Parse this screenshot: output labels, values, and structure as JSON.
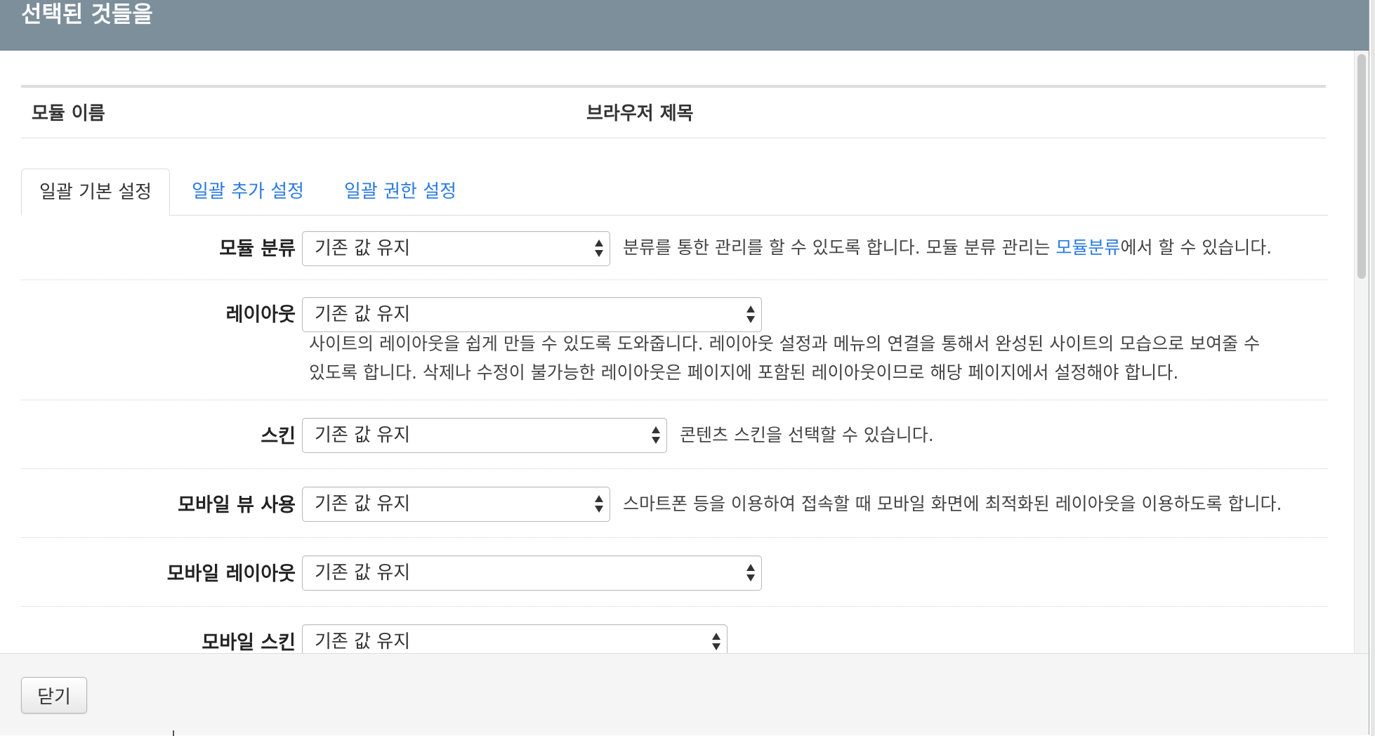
{
  "header": {
    "title": "선택된 것들을"
  },
  "table": {
    "col_module_name": "모듈 이름",
    "col_browser_title": "브라우저 제목"
  },
  "tabs": [
    {
      "label": "일괄 기본 설정",
      "active": true
    },
    {
      "label": "일괄 추가 설정",
      "active": false
    },
    {
      "label": "일괄 권한 설정",
      "active": false
    }
  ],
  "form": {
    "module_category": {
      "label": "모듈 분류",
      "value": "기존 값 유지",
      "help_before": "분류를 통한 관리를 할 수 있도록 합니다. 모듈 분류 관리는 ",
      "help_link": "모듈분류",
      "help_after": "에서 할 수 있습니다."
    },
    "layout": {
      "label": "레이아웃",
      "value": "기존 값 유지",
      "help_line1": "사이트의 레이아웃을 쉽게 만들 수 있도록 도와줍니다. 레이아웃 설정과 메뉴의 연결을 통해서 완성된 사이트의 모습으로 보여줄 수",
      "help_line2": "있도록 합니다. 삭제나 수정이 불가능한 레이아웃은 페이지에 포함된 레이아웃이므로 해당 페이지에서 설정해야 합니다."
    },
    "skin": {
      "label": "스킨",
      "value": "기존 값 유지",
      "help": "콘텐츠 스킨을 선택할 수 있습니다."
    },
    "mobile_view": {
      "label": "모바일 뷰 사용",
      "value": "기존 값 유지",
      "help": "스마트폰 등을 이용하여 접속할 때 모바일 화면에 최적화된 레이아웃을 이용하도록 합니다."
    },
    "mobile_layout": {
      "label": "모바일 레이아웃",
      "value": "기존 값 유지"
    },
    "mobile_skin": {
      "label": "모바일 스킨",
      "value": "기존 값 유지"
    }
  },
  "footer": {
    "close_label": "닫기"
  }
}
